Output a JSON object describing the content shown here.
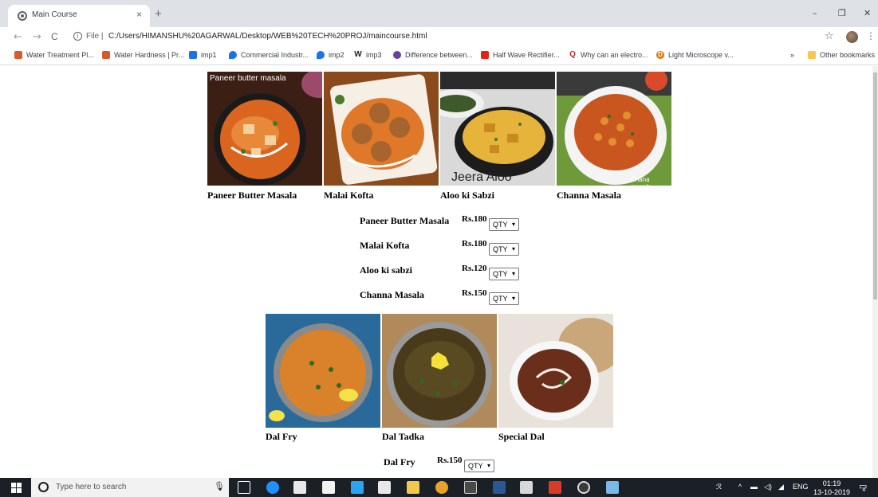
{
  "browser": {
    "tab_title": "Main Course",
    "tab_close": "×",
    "new_tab": "+",
    "url_prefix": "File |",
    "url": "C:/Users/HIMANSHU%20AGARWAL/Desktop/WEB%20TECH%20PROJ/maincourse.html",
    "window_controls": [
      "–",
      "❐",
      "✕"
    ],
    "nav": {
      "back": "←",
      "forward": "→",
      "reload": "C"
    },
    "bookmarks": [
      {
        "label": "Water Treatment Pl...",
        "icon": "water-treatment-icon",
        "color": "#d95b2b"
      },
      {
        "label": "Water Hardness | Pr...",
        "icon": "water-hardness-icon",
        "color": "#d95b2b"
      },
      {
        "label": "imp1",
        "icon": "drive-icon",
        "color": "#1a73e8"
      },
      {
        "label": "Commercial Industr...",
        "icon": "drop-icon",
        "color": "#1a73e8"
      },
      {
        "label": "imp2",
        "icon": "drop-icon",
        "color": "#1a73e8"
      },
      {
        "label": "imp3",
        "icon": "w-icon",
        "color": "#202124"
      },
      {
        "label": "Difference between...",
        "icon": "circle-icon",
        "color": "#6a3fa0"
      },
      {
        "label": "Half Wave Rectifier...",
        "icon": "youtube-icon",
        "color": "#e62117"
      },
      {
        "label": "Why can an electro...",
        "icon": "quora-icon",
        "color": "#b92b27"
      },
      {
        "label": "Light Microscope v...",
        "icon": "d-icon",
        "color": "#e37400"
      }
    ],
    "bookmarks_more": "»",
    "other_bookmarks": "Other bookmarks"
  },
  "menu_top": [
    {
      "name": "Paneer Butter Masala",
      "caption": "Paneer butter masala"
    },
    {
      "name": "Malai Kofta",
      "caption": ""
    },
    {
      "name": "Aloo ki Sabzi",
      "caption": "Jeera Aloo"
    },
    {
      "name": "Channa Masala",
      "caption": "Chana masala"
    }
  ],
  "order_top": [
    {
      "name": "Paneer Butter Masala",
      "price": "Rs.180",
      "qty": "QTY"
    },
    {
      "name": "Malai Kofta",
      "price": "Rs.180",
      "qty": "QTY"
    },
    {
      "name": "Aloo ki sabzi",
      "price": "Rs.120",
      "qty": "QTY"
    },
    {
      "name": "Channa Masala",
      "price": "Rs.150",
      "qty": "QTY"
    }
  ],
  "menu_bottom": [
    {
      "name": "Dal Fry"
    },
    {
      "name": "Dal Tadka"
    },
    {
      "name": "Special Dal"
    }
  ],
  "order_bottom": [
    {
      "name": "Dal Fry",
      "price": "Rs.150",
      "qty": "QTY"
    }
  ],
  "taskbar": {
    "search_placeholder": "Type here to search",
    "language": "ENG",
    "time": "01:19",
    "date": "13-10-2019",
    "notification_count": "4"
  }
}
